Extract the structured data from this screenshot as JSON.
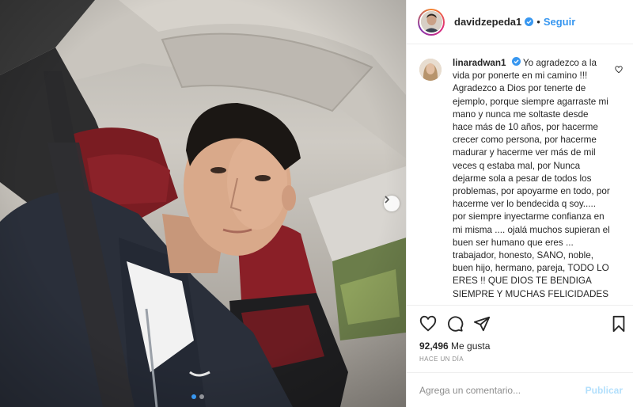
{
  "post": {
    "username": "davidzepeda1",
    "separator": "•",
    "follow_label": "Seguir",
    "verified_icon": "verified-badge-icon"
  },
  "comment": {
    "username": "linaradwan1",
    "text": "Yo agradezco a la vida por ponerte en mi camino !!! Agradezco a Dios por tenerte de ejemplo, porque siempre agarraste mi mano y nunca me soltaste desde hace más de 10 años, por hacerme crecer como persona, por hacerme madurar y hacerme ver más de mil veces q estaba mal, por Nunca dejarme sola a pesar de todos los problemas, por apoyarme en todo, por hacerme ver lo bendecida q soy..... por siempre inyectarme confianza en mi misma .... ojalá muchos supieran el buen ser humano que eres ... trabajador, honesto, SANO, noble, buen hijo, hermano, pareja, TODO LO ERES !! QUE DIOS TE BENDIGA SIEMPRE Y MUCHAS FELICIDADES",
    "like_icon": "heart-outline-icon"
  },
  "actions": {
    "icons": [
      "heart-icon",
      "comment-icon",
      "share-icon",
      "bookmark-icon"
    ]
  },
  "stats": {
    "likes_count": "92,496",
    "likes_label": "Me gusta",
    "time": "HACE UN DÍA"
  },
  "add_comment": {
    "placeholder": "Agrega un comentario...",
    "publish_label": "Publicar"
  },
  "carousel": {
    "total_slides": 2,
    "active_slide": 1
  },
  "colors": {
    "link_blue": "#3897f0",
    "publish_disabled": "#b2dffc",
    "text": "#262626",
    "muted": "#8e8e8e"
  }
}
